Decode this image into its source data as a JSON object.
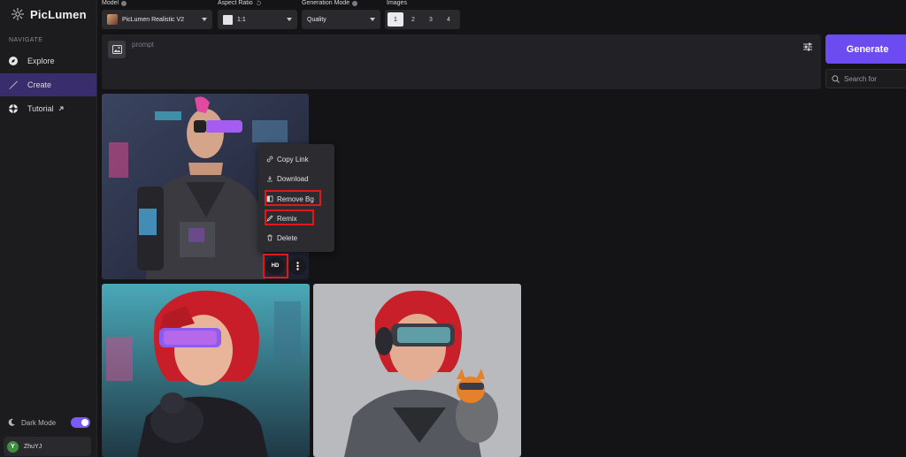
{
  "brand": {
    "name": "PicLumen"
  },
  "nav": {
    "header": "NAVIGATE",
    "items": [
      {
        "label": "Explore",
        "icon": "compass-icon"
      },
      {
        "label": "Create",
        "icon": "brush-icon",
        "active": true
      },
      {
        "label": "Tutorial",
        "icon": "life-ring-icon",
        "external": true
      }
    ]
  },
  "dark_mode": {
    "label": "Dark Mode",
    "enabled": true
  },
  "user": {
    "initial": "Y",
    "name": "ZhuYJ"
  },
  "controls": {
    "model": {
      "label": "Model",
      "value": "PicLumen Realistic V2"
    },
    "aspect_ratio": {
      "label": "Aspect Ratio",
      "value": "1:1"
    },
    "generation_mode": {
      "label": "Generation Mode",
      "value": "Quality"
    },
    "images": {
      "label": "Images",
      "options": [
        "1",
        "2",
        "3",
        "4"
      ],
      "selected": "1"
    }
  },
  "prompt": {
    "placeholder": "prompt"
  },
  "generate": {
    "label": "Generate"
  },
  "search": {
    "placeholder": "Search for"
  },
  "context_menu": {
    "items": [
      "Copy Link",
      "Download",
      "Remove Bg",
      "Remix",
      "Delete"
    ]
  },
  "hd_button": {
    "label": "HD"
  },
  "colors": {
    "accent": "#6c4cf0",
    "highlight": "#e01818",
    "sidebar_active": "#3a2d6e"
  }
}
